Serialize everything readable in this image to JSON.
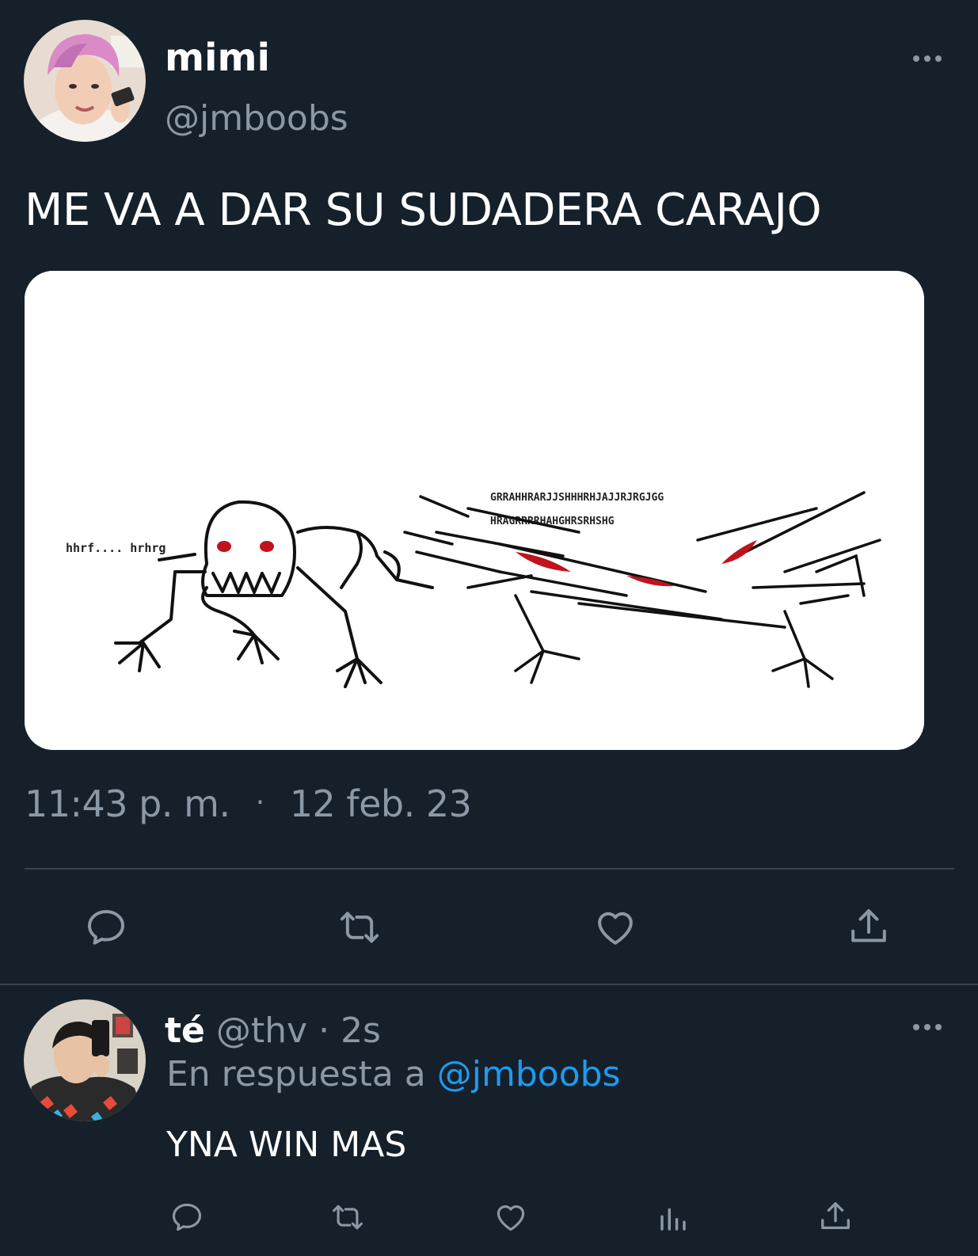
{
  "tweet": {
    "author_name": "mimi",
    "author_handle": "@jmboobs",
    "text": "ME VA A DAR SU SUDADERA CARAJO",
    "time": "11:43 p. m.",
    "separator": "·",
    "date": "12 feb. 23",
    "media_text": {
      "left_caption": "hhrf.... hrhrg",
      "right_caption_1": "GRRAHHRARJJSHHHRHJAJJRJRGJGG",
      "right_caption_2": "HRAGRRRRHAHGHRSRHSHG"
    },
    "actions": [
      "reply-icon",
      "retweet-icon",
      "like-icon",
      "share-icon"
    ]
  },
  "reply": {
    "author_name": "té",
    "author_handle": "@thv",
    "time_separator": "·",
    "time": "2s",
    "in_reply_prefix": "En respuesta a",
    "in_reply_mention": "@jmboobs",
    "text": "YNA WIN MAS",
    "actions": [
      "reply-icon",
      "retweet-icon",
      "like-icon",
      "views-icon",
      "share-icon"
    ]
  },
  "colors": {
    "background": "#15202b",
    "secondary_text": "#8b98a5",
    "accent": "#1d9bf0",
    "divider": "#38444d"
  }
}
